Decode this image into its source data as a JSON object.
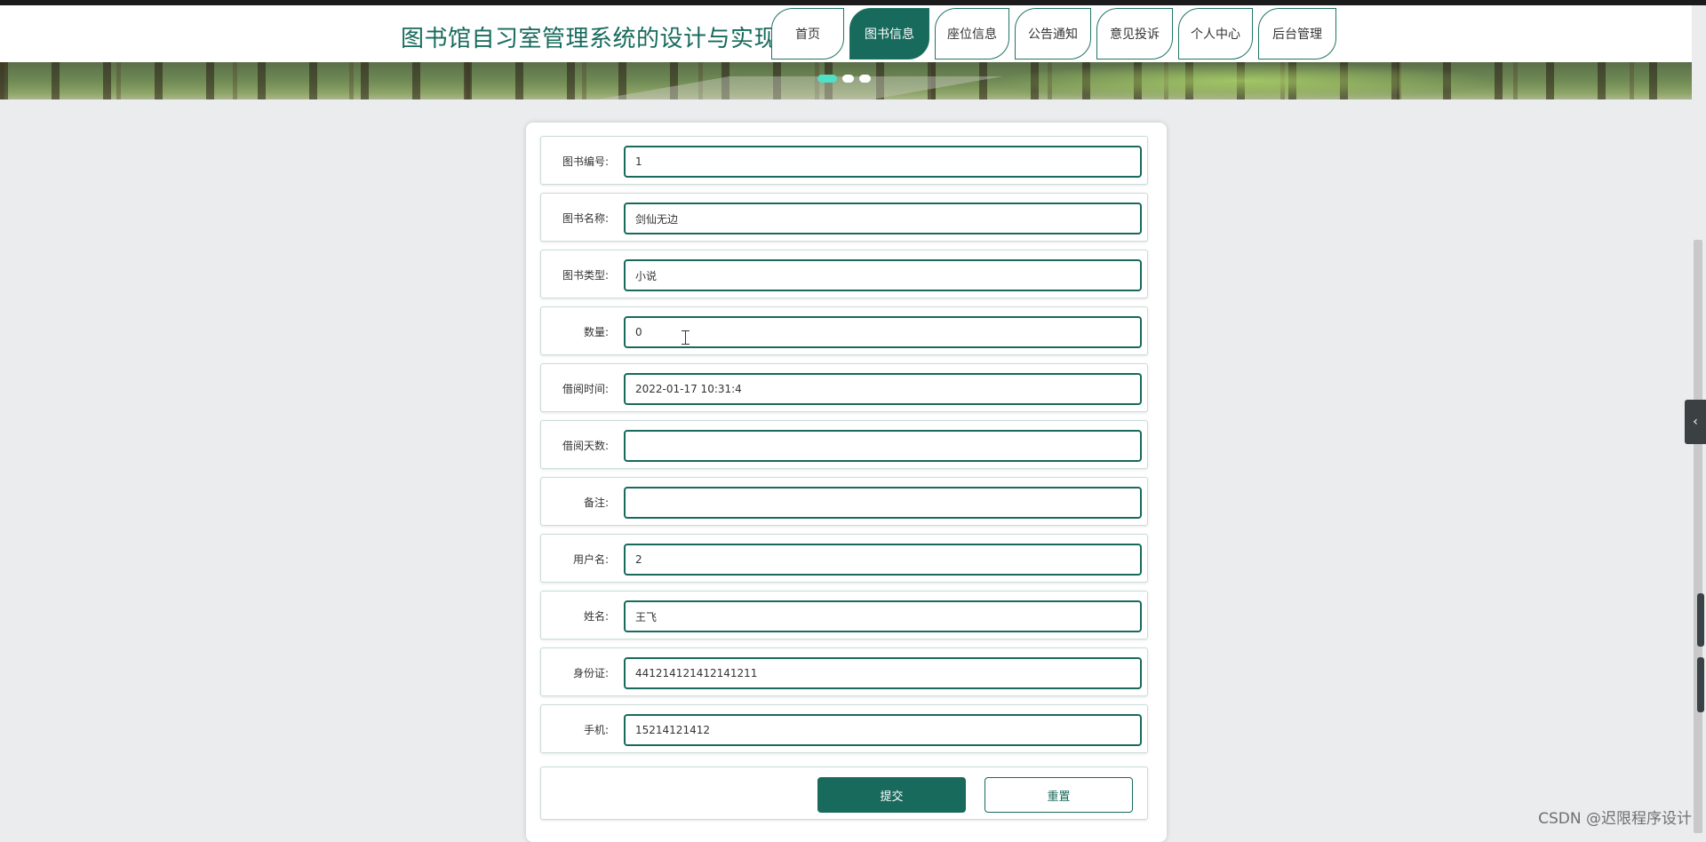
{
  "app": {
    "title": "图书馆自习室管理系统的设计与实现"
  },
  "nav": {
    "tabs": [
      {
        "label": "首页",
        "active": false
      },
      {
        "label": "图书信息",
        "active": true
      },
      {
        "label": "座位信息",
        "active": false
      },
      {
        "label": "公告通知",
        "active": false
      },
      {
        "label": "意见投诉",
        "active": false
      },
      {
        "label": "个人中心",
        "active": false
      },
      {
        "label": "后台管理",
        "active": false
      }
    ]
  },
  "banner": {
    "slide_count": 3,
    "active_slide": 1
  },
  "form": {
    "fields": [
      {
        "label": "图书编号:",
        "value": "1"
      },
      {
        "label": "图书名称:",
        "value": "剑仙无边"
      },
      {
        "label": "图书类型:",
        "value": "小说"
      },
      {
        "label": "数量:",
        "value": "0"
      },
      {
        "label": "借阅时间:",
        "value": "2022-01-17 10:31:4"
      },
      {
        "label": "借阅天数:",
        "value": ""
      },
      {
        "label": "备注:",
        "value": ""
      },
      {
        "label": "用户名:",
        "value": "2"
      },
      {
        "label": "姓名:",
        "value": "王飞"
      },
      {
        "label": "身份证:",
        "value": "441214121412141211"
      },
      {
        "label": "手机:",
        "value": "15214121412"
      }
    ],
    "submit_label": "提交",
    "reset_label": "重置"
  },
  "sidebar_toggle": {
    "icon": "chevron-left-icon",
    "glyph": "‹"
  },
  "watermark": "CSDN @迟限程序设计",
  "colors": {
    "primary": "#176a5c",
    "accent": "#4fe0c5",
    "page_bg": "#ebeced"
  }
}
